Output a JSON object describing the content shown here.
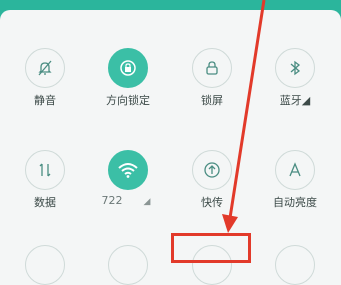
{
  "quick_settings": {
    "row1": [
      {
        "label": "静音",
        "icon": "bell-off-icon",
        "active": false
      },
      {
        "label": "方向锁定",
        "icon": "rotation-lock-icon",
        "active": true
      },
      {
        "label": "锁屏",
        "icon": "lock-icon",
        "active": false
      },
      {
        "label": "蓝牙◢",
        "icon": "bluetooth-icon",
        "active": false
      }
    ],
    "row2": [
      {
        "label": "数据",
        "icon": "data-arrows-icon",
        "active": false
      },
      {
        "label": "722",
        "icon": "wifi-icon",
        "active": true,
        "extra": "◢"
      },
      {
        "label": "快传",
        "icon": "upload-icon",
        "active": false
      },
      {
        "label": "自动亮度",
        "icon": "brightness-a-icon",
        "active": false
      }
    ]
  },
  "colors": {
    "accent": "#3bbfa6",
    "status_bar": "#2bb59c",
    "annotation": "#e23a2a"
  }
}
